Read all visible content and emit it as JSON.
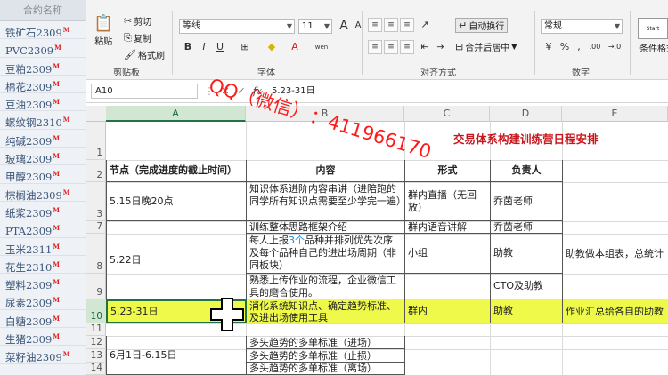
{
  "contracts": {
    "header": "合约名称",
    "marker": "M",
    "items": [
      "铁矿石2309",
      "PVC2309",
      "豆粕2309",
      "棉花2309",
      "豆油2309",
      "螺纹钢2310",
      "纯碱2309",
      "玻璃2309",
      "甲醇2309",
      "棕榈油2309",
      "纸浆2309",
      "PTA2309",
      "玉米2311",
      "花生2310",
      "塑料2309",
      "尿素2309",
      "白糖2309",
      "生猪2309",
      "菜籽油2309"
    ]
  },
  "ribbon": {
    "clipboard": {
      "paste": "粘贴",
      "cut": "剪切",
      "copy": "复制",
      "format_painter": "格式刷",
      "label": "剪贴板"
    },
    "font": {
      "font_name": "等线",
      "font_size": "11",
      "bold": "B",
      "italic": "I",
      "underline": "U",
      "label": "字体",
      "font_color": "A",
      "phonetic": "wén"
    },
    "alignment": {
      "wrap_text": "自动换行",
      "merge_center": "合并后居中",
      "label": "对齐方式"
    },
    "number": {
      "format": "常规",
      "label": "数字",
      "percent": "%",
      "comma": ",",
      "increase_decimal": ".00",
      "decrease_decimal": "→.0"
    },
    "styles": {
      "conditional_format": "条件格式"
    },
    "start_badge": "Start"
  },
  "formula_bar": {
    "name_box": "A10",
    "fx": "fx",
    "value": "5.23-31日"
  },
  "columns": [
    "A",
    "B",
    "C",
    "D",
    "E"
  ],
  "rows": [
    "1",
    "2",
    "3",
    "7",
    "8",
    "9",
    "10",
    "11",
    "12",
    "13",
    "14"
  ],
  "sheet": {
    "title": "交易体系构建训练营日程安排",
    "headers": [
      "节点（完成进度的截止时间）",
      "内容",
      "形式",
      "负责人"
    ],
    "row3": [
      "5.15日晚20点",
      "知识体系进阶内容串讲（进陪跑的同学所有知识点需要至少学完一遍）",
      "群内直播（无回放）",
      "乔茵老师"
    ],
    "row7": [
      "训练整体思路框架介绍",
      "群内语音讲解",
      "乔茵老师"
    ],
    "row8": {
      "a": "5.22日",
      "b_pre": "每人上报",
      "b_mid": "3个",
      "b_post": "品种并排列优先次序及每个品种自己的进出场周期（非同板块）",
      "c": "小组",
      "d": "助教",
      "e": "助教做本组表，总统计"
    },
    "row9": [
      "熟悉上传作业的流程，企业微信工具的磨合使用。",
      "CTO及助教"
    ],
    "row10": [
      "5.23-31日",
      "消化系统知识点、确定趋势标准、及进出场使用工具",
      "群内",
      "助教",
      "作业汇总给各自的助教"
    ],
    "row12": "多头趋势的多单标准（进场）",
    "row13": {
      "a": "6月1日-6.15日",
      "b": "多头趋势的多单标准（止损）"
    },
    "row14": "多头趋势的多单标准（离场）"
  },
  "watermark": {
    "part1": "QQ（微信）",
    "part2": "：411966170"
  }
}
